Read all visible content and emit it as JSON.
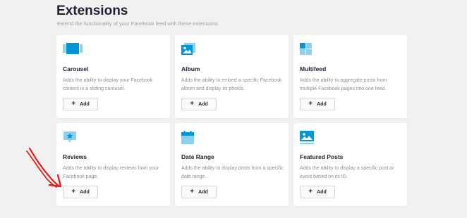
{
  "header": {
    "title": "Extensions",
    "subtitle": "Extend the functionality of your Facebook feed with these extensions"
  },
  "colors": {
    "accent": "#0096d8",
    "accent_light": "#8ecff0",
    "annotation_arrow": "#e02020"
  },
  "cards": [
    {
      "icon": "carousel-icon",
      "title": "Carousel",
      "description": "Adds the ability to display your Facebook content in a sliding carousel.",
      "button_label": "Add"
    },
    {
      "icon": "album-icon",
      "title": "Album",
      "description": "Adds the ability to embed a specific Facebook album and display its photos.",
      "button_label": "Add"
    },
    {
      "icon": "multifeed-icon",
      "title": "Multifeed",
      "description": "Adds the ability to aggregate posts from multiple Facebook pages into one feed.",
      "button_label": "Add"
    },
    {
      "icon": "reviews-icon",
      "title": "Reviews",
      "description": "Adds the ability to display reviews from your Facebook page.",
      "button_label": "Add"
    },
    {
      "icon": "date-range-icon",
      "title": "Date Range",
      "description": "Adds the ability to display posts from a specific date range.",
      "button_label": "Add"
    },
    {
      "icon": "featured-posts-icon",
      "title": "Featured Posts",
      "description": "Adds the ability to display a specific post or event based on its ID.",
      "button_label": "Add"
    }
  ]
}
